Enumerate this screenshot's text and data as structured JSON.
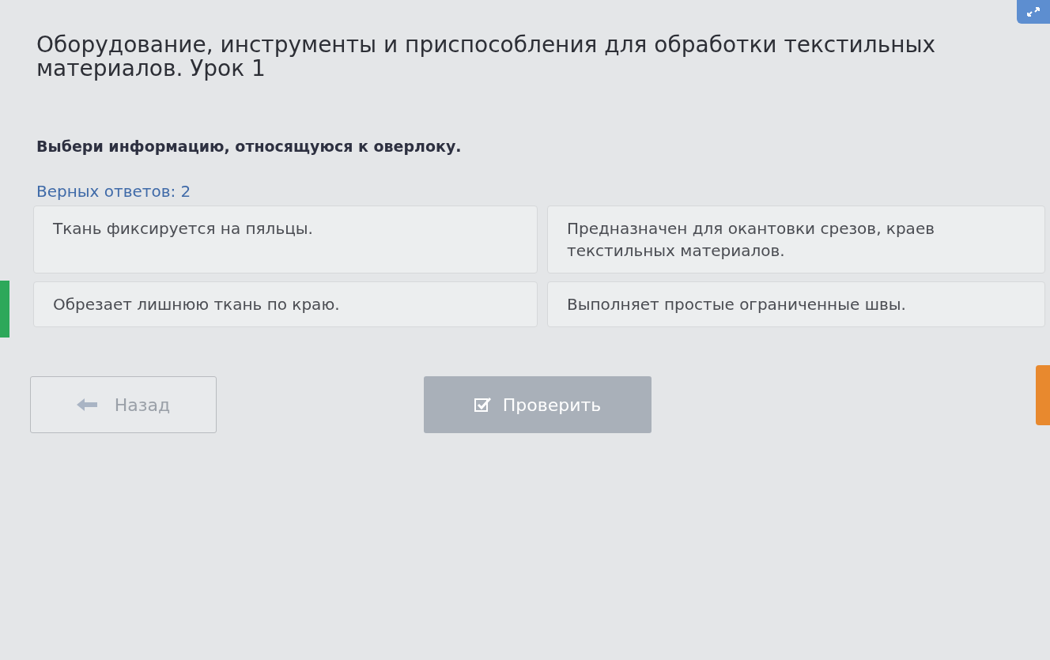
{
  "title": "Оборудование, инструменты и приспособления для обработки текстильных материалов. Урок 1",
  "question": "Выбери информацию, относящуюся к оверлоку.",
  "answers_hint": "Верных ответов: 2",
  "options": [
    {
      "text": "Ткань фиксируется на пяльцы.",
      "selected": false
    },
    {
      "text": "Предназначен для окантовки срезов, краев текстильных материалов.",
      "selected": false
    },
    {
      "text": "Обрезает лишнюю ткань по краю.",
      "selected": false
    },
    {
      "text": "Выполняет простые ограниченные швы.",
      "selected": false
    }
  ],
  "back_button": {
    "label": "Назад"
  },
  "check_button": {
    "label": "Проверить",
    "disabled": true
  }
}
